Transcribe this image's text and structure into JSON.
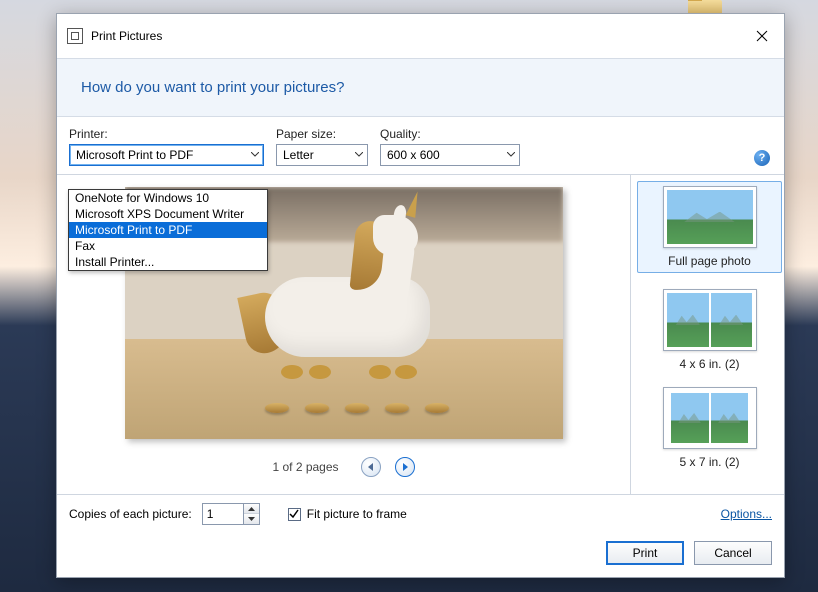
{
  "window": {
    "title": "Print Pictures"
  },
  "header": {
    "question": "How do you want to print your pictures?"
  },
  "labels": {
    "printer": "Printer:",
    "paper": "Paper size:",
    "quality": "Quality:",
    "copies": "Copies of each picture:",
    "fit": "Fit picture to frame",
    "options": "Options..."
  },
  "selects": {
    "printer_value": "Microsoft Print to PDF",
    "paper_value": "Letter",
    "quality_value": "600 x 600"
  },
  "printer_options": {
    "o0": "OneNote for Windows 10",
    "o1": "Microsoft XPS Document Writer",
    "o2": "Microsoft Print to PDF",
    "o3": "Fax",
    "o4": "Install Printer..."
  },
  "pager": {
    "text": "1 of 2 pages"
  },
  "copies": {
    "value": "1"
  },
  "fit_checked": true,
  "layouts": {
    "l0": "Full page photo",
    "l1": "4 x 6 in. (2)",
    "l2": "5 x 7 in. (2)"
  },
  "buttons": {
    "print": "Print",
    "cancel": "Cancel"
  }
}
